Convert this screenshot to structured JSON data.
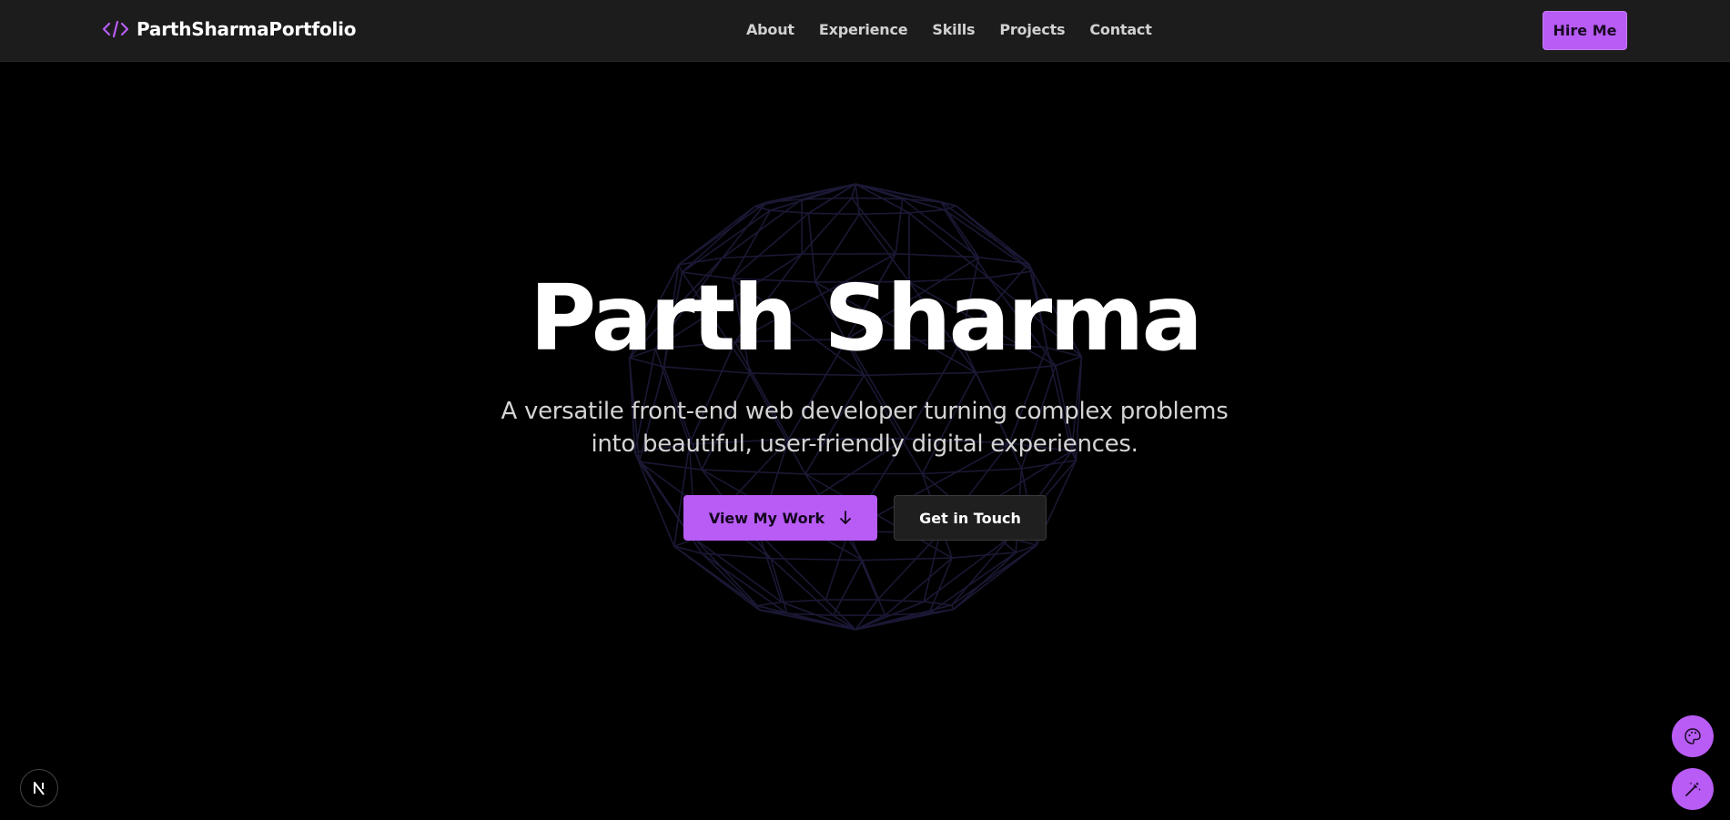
{
  "brand": {
    "name": "ParthSharmaPortfolio",
    "icon": "code-icon"
  },
  "nav": {
    "items": [
      "About",
      "Experience",
      "Skills",
      "Projects",
      "Contact"
    ]
  },
  "header": {
    "cta_label": "Hire Me"
  },
  "hero": {
    "title": "Parth Sharma",
    "subtitle": "A versatile front-end web developer turning complex problems into beautiful, user-friendly digital experiences.",
    "primary_button": "View My Work",
    "primary_button_icon": "arrow-down-icon",
    "secondary_button": "Get in Touch",
    "background_graphic": "wireframe-sphere"
  },
  "floating": {
    "left_badge_icon": "nextjs-icon",
    "right_buttons": [
      "palette-icon",
      "magic-wand-icon"
    ]
  },
  "colors": {
    "accent": "#b85cf5",
    "navbar_bg": "#1c1c1c",
    "page_bg": "#000000",
    "nav_text": "#d1d1d1",
    "subtitle_text": "#d4d4d4",
    "sphere_lines": "#1d1b3a"
  }
}
